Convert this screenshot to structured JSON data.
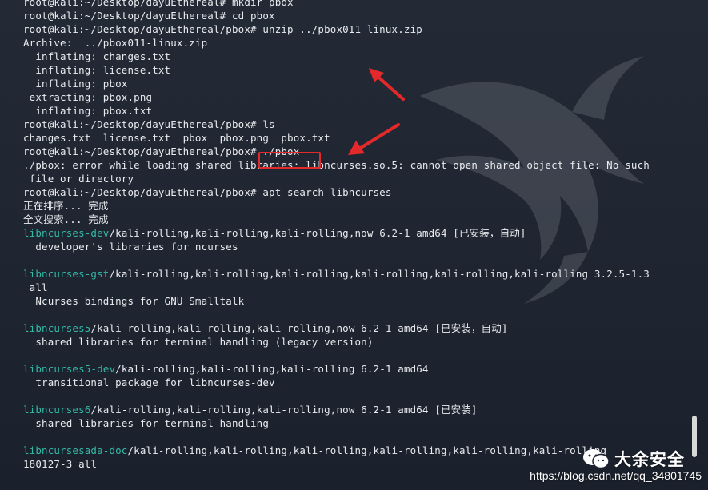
{
  "terminal": {
    "lines": [
      {
        "text": "root@kali:~/Desktop/dayuEthereal# mkdir pbox"
      },
      {
        "text": "root@kali:~/Desktop/dayuEthereal# cd pbox"
      },
      {
        "text": "root@kali:~/Desktop/dayuEthereal/pbox# unzip ../pbox011-linux.zip"
      },
      {
        "text": "Archive:  ../pbox011-linux.zip"
      },
      {
        "text": "  inflating: changes.txt"
      },
      {
        "text": "  inflating: license.txt"
      },
      {
        "text": "  inflating: pbox"
      },
      {
        "text": " extracting: pbox.png"
      },
      {
        "text": "  inflating: pbox.txt"
      },
      {
        "text": "root@kali:~/Desktop/dayuEthereal/pbox# ls"
      },
      {
        "text": "changes.txt  license.txt  pbox  pbox.png  pbox.txt"
      },
      {
        "text": "root@kali:~/Desktop/dayuEthereal/pbox# ./pbox"
      },
      {
        "text": "./pbox: error while loading shared libraries: libncurses.so.5: cannot open shared object file: No such"
      },
      {
        "text": " file or directory"
      },
      {
        "text": "root@kali:~/Desktop/dayuEthereal/pbox# apt search libncurses"
      },
      {
        "text": "正在排序... 完成"
      },
      {
        "text": "全文搜索... 完成"
      },
      {
        "pkg": "libncurses-dev",
        "rest": "/kali-rolling,kali-rolling,kali-rolling,now 6.2-1 amd64 [已安装，自动]"
      },
      {
        "text": "  developer's libraries for ncurses"
      },
      {
        "text": ""
      },
      {
        "pkg": "libncurses-gst",
        "rest": "/kali-rolling,kali-rolling,kali-rolling,kali-rolling,kali-rolling,kali-rolling 3.2.5-1.3"
      },
      {
        "text": " all"
      },
      {
        "text": "  Ncurses bindings for GNU Smalltalk"
      },
      {
        "text": ""
      },
      {
        "pkg": "libncurses5",
        "rest": "/kali-rolling,kali-rolling,kali-rolling,now 6.2-1 amd64 [已安装，自动]"
      },
      {
        "text": "  shared libraries for terminal handling (legacy version)"
      },
      {
        "text": ""
      },
      {
        "pkg": "libncurses5-dev",
        "rest": "/kali-rolling,kali-rolling,kali-rolling 6.2-1 amd64"
      },
      {
        "text": "  transitional package for libncurses-dev"
      },
      {
        "text": ""
      },
      {
        "pkg": "libncurses6",
        "rest": "/kali-rolling,kali-rolling,kali-rolling,now 6.2-1 amd64 [已安装]"
      },
      {
        "text": "  shared libraries for terminal handling"
      },
      {
        "text": ""
      },
      {
        "pkg": "libncursesada-doc",
        "rest": "/kali-rolling,kali-rolling,kali-rolling,kali-rolling,kali-rolling,kali-rolling"
      },
      {
        "text": "180127-3 all"
      }
    ]
  },
  "watermark": {
    "brand": "大余安全",
    "url": "https://blog.csdn.net/qq_34801745"
  },
  "colors": {
    "background": "#1f2531",
    "text": "#e9ebee",
    "package_name": "#33b9a6",
    "annotation_red": "#e4292b"
  }
}
